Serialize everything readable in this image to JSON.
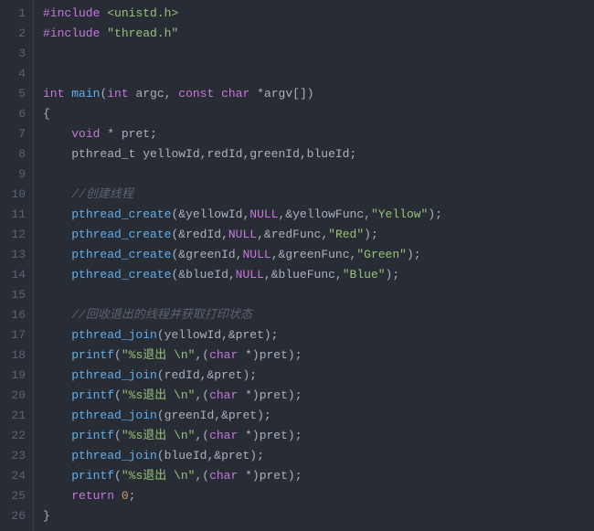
{
  "lines": [
    {
      "n": "1",
      "segs": [
        [
          "pp",
          "#include"
        ],
        [
          "p",
          " "
        ],
        [
          "hdr",
          "<unistd.h>"
        ]
      ]
    },
    {
      "n": "2",
      "segs": [
        [
          "pp",
          "#include"
        ],
        [
          "p",
          " "
        ],
        [
          "hdr",
          "\"thread.h\""
        ]
      ]
    },
    {
      "n": "3",
      "segs": [
        [
          "p",
          ""
        ]
      ]
    },
    {
      "n": "4",
      "segs": [
        [
          "p",
          ""
        ]
      ]
    },
    {
      "n": "5",
      "segs": [
        [
          "type",
          "int"
        ],
        [
          "p",
          " "
        ],
        [
          "fn",
          "main"
        ],
        [
          "p",
          "("
        ],
        [
          "type",
          "int"
        ],
        [
          "p",
          " argc, "
        ],
        [
          "type",
          "const"
        ],
        [
          "p",
          " "
        ],
        [
          "type",
          "char"
        ],
        [
          "p",
          " "
        ],
        [
          "op",
          "*"
        ],
        [
          "p",
          "argv[])"
        ]
      ]
    },
    {
      "n": "6",
      "segs": [
        [
          "p",
          "{"
        ]
      ]
    },
    {
      "n": "7",
      "segs": [
        [
          "p",
          "    "
        ],
        [
          "type",
          "void"
        ],
        [
          "p",
          " "
        ],
        [
          "op",
          "*"
        ],
        [
          "p",
          " pret;"
        ]
      ]
    },
    {
      "n": "8",
      "segs": [
        [
          "p",
          "    "
        ],
        [
          "id",
          "pthread_t"
        ],
        [
          "p",
          " yellowId,redId,greenId,blueId;"
        ]
      ]
    },
    {
      "n": "9",
      "segs": [
        [
          "p",
          ""
        ]
      ]
    },
    {
      "n": "10",
      "segs": [
        [
          "p",
          "    "
        ],
        [
          "cmt",
          "//创建线程"
        ]
      ]
    },
    {
      "n": "11",
      "segs": [
        [
          "p",
          "    "
        ],
        [
          "fn",
          "pthread_create"
        ],
        [
          "p",
          "("
        ],
        [
          "op",
          "&"
        ],
        [
          "p",
          "yellowId,"
        ],
        [
          "kw",
          "NULL"
        ],
        [
          "p",
          ","
        ],
        [
          "op",
          "&"
        ],
        [
          "p",
          "yellowFunc,"
        ],
        [
          "str",
          "\"Yellow\""
        ],
        [
          "p",
          ");"
        ]
      ]
    },
    {
      "n": "12",
      "segs": [
        [
          "p",
          "    "
        ],
        [
          "fn",
          "pthread_create"
        ],
        [
          "p",
          "("
        ],
        [
          "op",
          "&"
        ],
        [
          "p",
          "redId,"
        ],
        [
          "kw",
          "NULL"
        ],
        [
          "p",
          ","
        ],
        [
          "op",
          "&"
        ],
        [
          "p",
          "redFunc,"
        ],
        [
          "str",
          "\"Red\""
        ],
        [
          "p",
          ");"
        ]
      ]
    },
    {
      "n": "13",
      "segs": [
        [
          "p",
          "    "
        ],
        [
          "fn",
          "pthread_create"
        ],
        [
          "p",
          "("
        ],
        [
          "op",
          "&"
        ],
        [
          "p",
          "greenId,"
        ],
        [
          "kw",
          "NULL"
        ],
        [
          "p",
          ","
        ],
        [
          "op",
          "&"
        ],
        [
          "p",
          "greenFunc,"
        ],
        [
          "str",
          "\"Green\""
        ],
        [
          "p",
          ");"
        ]
      ]
    },
    {
      "n": "14",
      "segs": [
        [
          "p",
          "    "
        ],
        [
          "fn",
          "pthread_create"
        ],
        [
          "p",
          "("
        ],
        [
          "op",
          "&"
        ],
        [
          "p",
          "blueId,"
        ],
        [
          "kw",
          "NULL"
        ],
        [
          "p",
          ","
        ],
        [
          "op",
          "&"
        ],
        [
          "p",
          "blueFunc,"
        ],
        [
          "str",
          "\"Blue\""
        ],
        [
          "p",
          ");"
        ]
      ]
    },
    {
      "n": "15",
      "segs": [
        [
          "p",
          ""
        ]
      ]
    },
    {
      "n": "16",
      "segs": [
        [
          "p",
          "    "
        ],
        [
          "cmt",
          "//回收退出的线程并获取打印状态"
        ]
      ]
    },
    {
      "n": "17",
      "segs": [
        [
          "p",
          "    "
        ],
        [
          "fn",
          "pthread_join"
        ],
        [
          "p",
          "(yellowId,"
        ],
        [
          "op",
          "&"
        ],
        [
          "p",
          "pret);"
        ]
      ]
    },
    {
      "n": "18",
      "segs": [
        [
          "p",
          "    "
        ],
        [
          "fn",
          "printf"
        ],
        [
          "p",
          "("
        ],
        [
          "str",
          "\"%s退出 \\n\""
        ],
        [
          "p",
          ",("
        ],
        [
          "type",
          "char"
        ],
        [
          "p",
          " "
        ],
        [
          "op",
          "*"
        ],
        [
          "p",
          ")pret);"
        ]
      ]
    },
    {
      "n": "19",
      "segs": [
        [
          "p",
          "    "
        ],
        [
          "fn",
          "pthread_join"
        ],
        [
          "p",
          "(redId,"
        ],
        [
          "op",
          "&"
        ],
        [
          "p",
          "pret);"
        ]
      ]
    },
    {
      "n": "20",
      "segs": [
        [
          "p",
          "    "
        ],
        [
          "fn",
          "printf"
        ],
        [
          "p",
          "("
        ],
        [
          "str",
          "\"%s退出 \\n\""
        ],
        [
          "p",
          ",("
        ],
        [
          "type",
          "char"
        ],
        [
          "p",
          " "
        ],
        [
          "op",
          "*"
        ],
        [
          "p",
          ")pret);"
        ]
      ]
    },
    {
      "n": "21",
      "segs": [
        [
          "p",
          "    "
        ],
        [
          "fn",
          "pthread_join"
        ],
        [
          "p",
          "(greenId,"
        ],
        [
          "op",
          "&"
        ],
        [
          "p",
          "pret);"
        ]
      ]
    },
    {
      "n": "22",
      "segs": [
        [
          "p",
          "    "
        ],
        [
          "fn",
          "printf"
        ],
        [
          "p",
          "("
        ],
        [
          "str",
          "\"%s退出 \\n\""
        ],
        [
          "p",
          ",("
        ],
        [
          "type",
          "char"
        ],
        [
          "p",
          " "
        ],
        [
          "op",
          "*"
        ],
        [
          "p",
          ")pret);"
        ]
      ]
    },
    {
      "n": "23",
      "segs": [
        [
          "p",
          "    "
        ],
        [
          "fn",
          "pthread_join"
        ],
        [
          "p",
          "(blueId,"
        ],
        [
          "op",
          "&"
        ],
        [
          "p",
          "pret);"
        ]
      ]
    },
    {
      "n": "24",
      "segs": [
        [
          "p",
          "    "
        ],
        [
          "fn",
          "printf"
        ],
        [
          "p",
          "("
        ],
        [
          "str",
          "\"%s退出 \\n\""
        ],
        [
          "p",
          ",("
        ],
        [
          "type",
          "char"
        ],
        [
          "p",
          " "
        ],
        [
          "op",
          "*"
        ],
        [
          "p",
          ")pret);"
        ]
      ]
    },
    {
      "n": "25",
      "segs": [
        [
          "p",
          "    "
        ],
        [
          "kw",
          "return"
        ],
        [
          "p",
          " "
        ],
        [
          "num",
          "0"
        ],
        [
          "p",
          ";"
        ]
      ]
    },
    {
      "n": "26",
      "segs": [
        [
          "p",
          "}"
        ]
      ]
    }
  ]
}
